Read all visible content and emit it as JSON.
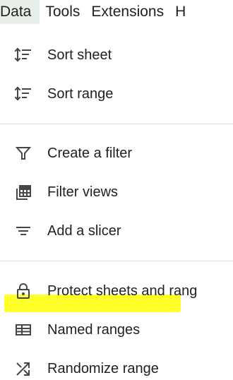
{
  "menubar": {
    "items": [
      {
        "label": "Data",
        "active": true
      },
      {
        "label": "Tools"
      },
      {
        "label": "Extensions"
      },
      {
        "label": "H"
      }
    ]
  },
  "menu": {
    "items": [
      {
        "label": "Sort sheet",
        "icon": "sort-icon"
      },
      {
        "label": "Sort range",
        "icon": "sort-icon"
      },
      {
        "label": "Create a filter",
        "icon": "filter-icon"
      },
      {
        "label": "Filter views",
        "icon": "filter-views-icon"
      },
      {
        "label": "Add a slicer",
        "icon": "slicer-icon"
      },
      {
        "label": "Protect sheets and rang",
        "icon": "lock-icon"
      },
      {
        "label": "Named ranges",
        "icon": "named-ranges-icon",
        "highlighted": true
      },
      {
        "label": "Randomize range",
        "icon": "shuffle-icon"
      }
    ]
  },
  "colors": {
    "highlight": "#ffff2a",
    "active_menu_bg": "#e8f0e9",
    "text": "#202124",
    "icon": "#444746",
    "divider": "#dadce0"
  }
}
